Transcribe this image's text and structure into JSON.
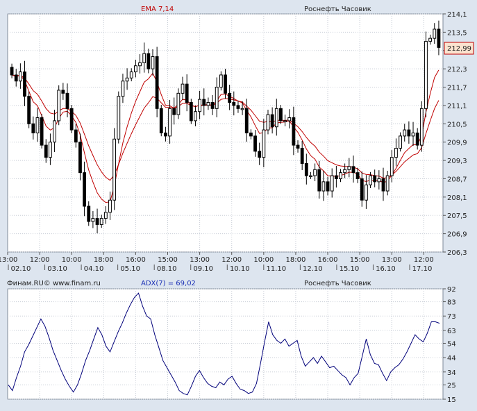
{
  "price_panel": {
    "indicator_label": "EMA 7,14",
    "instrument_label": "Роснефть Часовик",
    "last_price_badge": "212,99"
  },
  "adx_panel": {
    "source_label": "Финам.RU© www.finam.ru",
    "indicator_label": "ADX(7) = 69,02",
    "instrument_label": "Роснефть Часовик"
  },
  "colors": {
    "background": "#dde5ef",
    "plot_bg": "#ffffff",
    "grid": "#c8cdd6",
    "candle": "#000000",
    "ema_line": "#c00000",
    "adx_line": "#00007a",
    "badge_fill": "#fbe3cf",
    "badge_border": "#c00000",
    "indicator_label_ema": "#c00000",
    "indicator_label_adx": "#1a2fb5"
  },
  "chart_data": [
    {
      "type": "candlestick",
      "title": "Роснефть Часовик",
      "indicator": "EMA 7,14",
      "ylim": [
        206.3,
        214.1
      ],
      "y_ticks": [
        "214,1",
        "213,5",
        "212,9",
        "212,3",
        "211,7",
        "211,1",
        "210,5",
        "209,9",
        "209,3",
        "208,7",
        "208,1",
        "207,5",
        "206,9",
        "206,3"
      ],
      "x_time_labels": [
        "13:00",
        "12:00",
        "10:00",
        "18:00",
        "16:00",
        "15:00",
        "13:00",
        "12:00",
        "10:00",
        "18:00",
        "16:00",
        "15:00",
        "13:00",
        "12:00"
      ],
      "x_date_labels": [
        "02.10",
        "03.10",
        "04.10",
        "05.10",
        "08.10",
        "09.10",
        "10.10",
        "11.10",
        "12.10",
        "15.10",
        "16.10",
        "17.10"
      ],
      "grid": true,
      "last_value": 212.99,
      "close": [
        212.1,
        211.9,
        212.2,
        211.4,
        210.5,
        210.2,
        210.7,
        209.8,
        209.4,
        209.9,
        210.6,
        211.6,
        211.5,
        211.0,
        210.3,
        209.9,
        208.9,
        207.8,
        207.3,
        207.4,
        207.2,
        207.4,
        207.6,
        208.0,
        210.0,
        211.4,
        211.9,
        212.0,
        212.2,
        212.4,
        212.5,
        212.8,
        212.3,
        212.7,
        211.0,
        210.2,
        210.1,
        211.0,
        210.8,
        211.5,
        211.8,
        211.2,
        210.6,
        210.9,
        211.3,
        211.1,
        211.2,
        211.0,
        211.7,
        212.1,
        211.5,
        211.2,
        211.1,
        211.0,
        211.0,
        210.2,
        210.1,
        209.6,
        209.4,
        210.3,
        210.8,
        210.4,
        211.0,
        210.6,
        210.6,
        210.7,
        209.8,
        209.7,
        209.2,
        208.8,
        208.8,
        209.0,
        208.3,
        208.6,
        208.3,
        208.8,
        208.7,
        208.9,
        209.0,
        209.1,
        208.9,
        208.7,
        208.0,
        208.5,
        208.8,
        208.6,
        208.7,
        208.3,
        208.8,
        209.4,
        209.7,
        210.1,
        210.3,
        210.1,
        210.2,
        209.8,
        211.0,
        213.2,
        213.3,
        213.6,
        213.0
      ]
    },
    {
      "type": "line",
      "title": "Роснефть Часовик",
      "series": [
        {
          "name": "ADX(7) = 69,02",
          "values": [
            25,
            21,
            30,
            38,
            48,
            53,
            59,
            65,
            71,
            66,
            58,
            49,
            42,
            35,
            29,
            24,
            20,
            25,
            33,
            42,
            49,
            57,
            65,
            60,
            52,
            48,
            55,
            62,
            68,
            75,
            81,
            86,
            89,
            80,
            73,
            71,
            60,
            51,
            42,
            37,
            32,
            27,
            21,
            19,
            18,
            24,
            31,
            35,
            30,
            26,
            24,
            23,
            27,
            25,
            29,
            31,
            26,
            22,
            21,
            19,
            20,
            26,
            40,
            55,
            69,
            60,
            56,
            54,
            57,
            52,
            54,
            56,
            45,
            38,
            41,
            44,
            40,
            45,
            41,
            37,
            38,
            35,
            32,
            30,
            25,
            30,
            33,
            45,
            57,
            46,
            40,
            39,
            33,
            28,
            34,
            37,
            39,
            43,
            48,
            54,
            60,
            57,
            55,
            61,
            69,
            69,
            68
          ]
        }
      ],
      "ylim": [
        15,
        92
      ],
      "y_ticks": [
        "92",
        "83",
        "73",
        "63",
        "54",
        "44",
        "34",
        "25",
        "15"
      ],
      "grid": true
    }
  ]
}
